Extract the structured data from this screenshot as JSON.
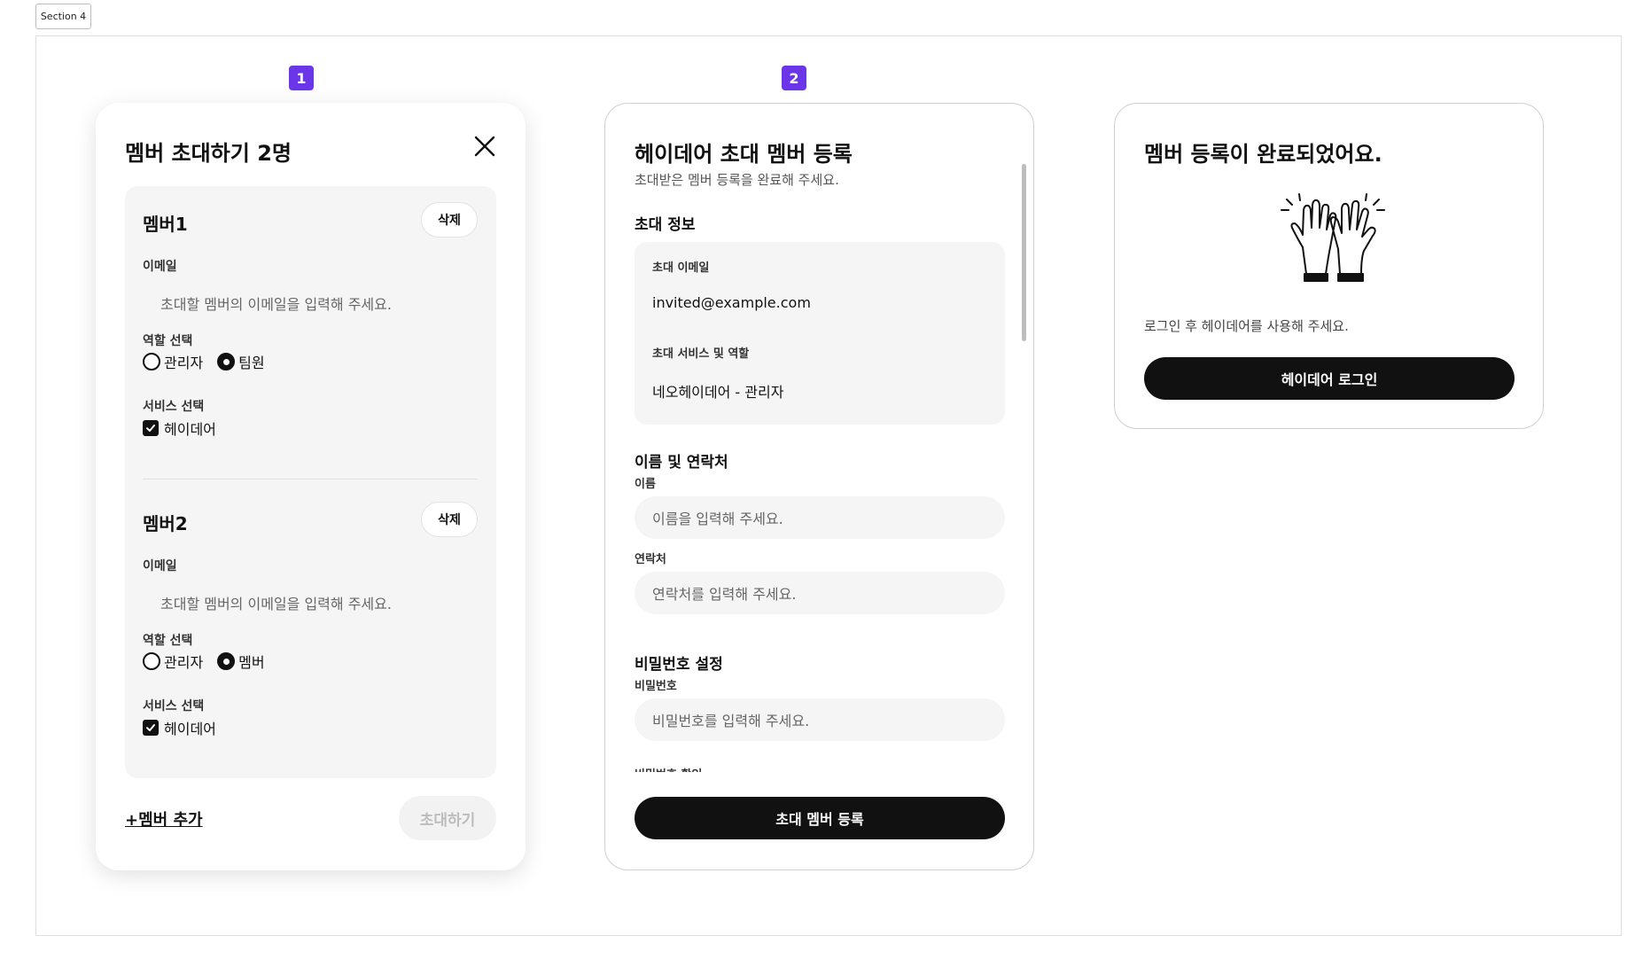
{
  "section_label": "Section 4",
  "steps": [
    "1",
    "2"
  ],
  "invite_modal": {
    "title": "멤버 초대하기 2명",
    "members": [
      {
        "title": "멤버1",
        "delete_label": "삭제",
        "email_label": "이메일",
        "email_placeholder": "초대할 멤버의 이메일을 입력해 주세요.",
        "role_label": "역할 선택",
        "roles": [
          "관리자",
          "팀원"
        ],
        "selected_role": "팀원",
        "service_label": "서비스 선택",
        "service": "헤이데어",
        "service_checked": true
      },
      {
        "title": "멤버2",
        "delete_label": "삭제",
        "email_label": "이메일",
        "email_placeholder": "초대할 멤버의 이메일을 입력해 주세요.",
        "role_label": "역할 선택",
        "roles": [
          "관리자",
          "멤버"
        ],
        "selected_role": "멤버",
        "service_label": "서비스 선택",
        "service": "헤이데어",
        "service_checked": true
      }
    ],
    "add_member_label": "+멤버 추가",
    "invite_button_label": "초대하기"
  },
  "register_form": {
    "title": "헤이데어 초대 멤버 등록",
    "subtitle": "초대받은 멤버 등록을 완료해 주세요.",
    "invite_info_heading": "초대 정보",
    "invite_email_label": "초대 이메일",
    "invite_email_value": "invited@example.com",
    "invite_service_label": "초대 서비스 및 역할",
    "invite_service_value": "네오헤이데어 - 관리자",
    "contact_heading": "이름 및 연락처",
    "name_label": "이름",
    "name_placeholder": "이름을 입력해 주세요.",
    "phone_label": "연락처",
    "phone_placeholder": "연락처를 입력해 주세요.",
    "password_heading": "비밀번호 설정",
    "password_label": "비밀번호",
    "password_placeholder": "비밀번호를 입력해 주세요.",
    "password_confirm_label": "비밀번호 확인",
    "submit_label": "초대 멤버 등록"
  },
  "complete": {
    "title": "멤버 등록이 완료되었어요.",
    "illustration": "high-five-hands",
    "message": "로그인 후 헤이데어를 사용해 주세요.",
    "login_button_label": "헤이데어 로그인"
  },
  "colors": {
    "accent": "#6b35e8",
    "primary_button": "#111111",
    "field_bg": "#f5f5f5"
  }
}
